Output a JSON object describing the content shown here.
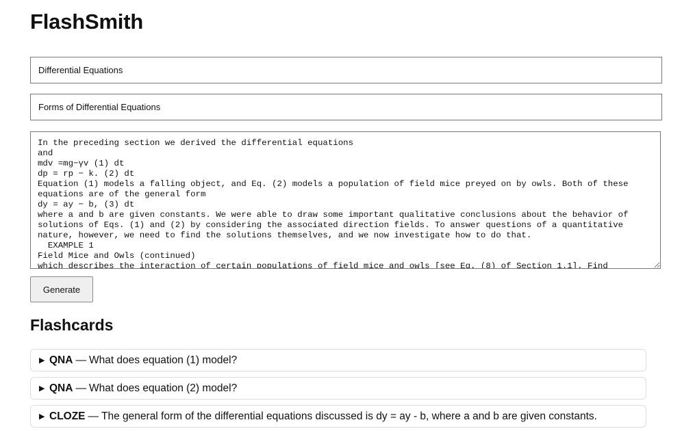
{
  "app": {
    "title": "FlashSmith"
  },
  "form": {
    "deck_value": "Differential Equations",
    "section_value": "Forms of Differential Equations",
    "source_text": "In the preceding section we derived the differential equations\nand\nmdv =mg−γv (1) dt\ndp = rp − k. (2) dt\nEquation (1) models a falling object, and Eq. (2) models a population of field mice preyed on by owls. Both of these equations are of the general form\ndy = ay − b, (3) dt\nwhere a and b are given constants. We were able to draw some important qualitative conclusions about the behavior of solutions of Eqs. (1) and (2) by considering the associated direction fields. To answer questions of a quantitative nature, however, we need to find the solutions themselves, and we now investigate how to do that.\n  EXAMPLE 1\nField Mice and Owls (continued)\nwhich describes the interaction of certain populations of field mice and owls [see Eq. (8) of Section 1.1]. Find",
    "generate_label": "Generate"
  },
  "flashcards": {
    "heading": "Flashcards",
    "separator": "—",
    "toggle_glyph": "▶",
    "items": [
      {
        "type": "QNA",
        "text": "What does equation (1) model?"
      },
      {
        "type": "QNA",
        "text": "What does equation (2) model?"
      },
      {
        "type": "CLOZE",
        "text": "The general form of the differential equations discussed is dy = ay - b, where a and b are given constants."
      }
    ]
  }
}
